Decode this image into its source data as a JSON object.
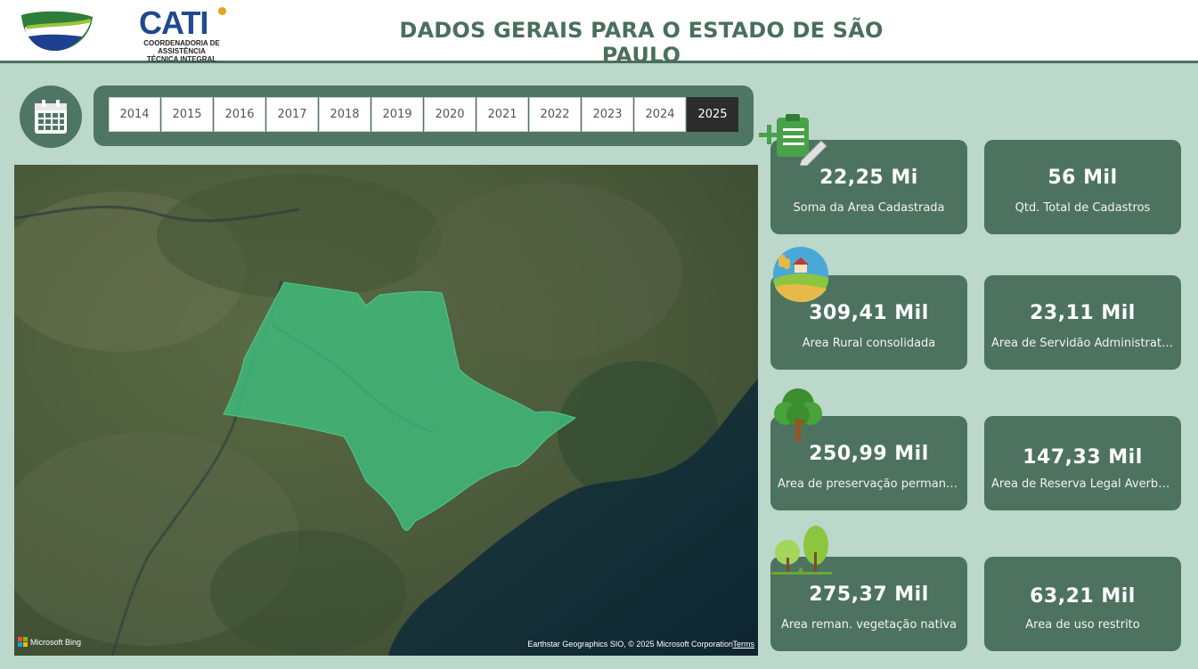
{
  "header": {
    "title": "DADOS GERAIS PARA O ESTADO DE SÃO PAULO",
    "org_logo": {
      "word": "CATI",
      "subtitle_line1": "COORDENADORIA DE ASSISTÊNCIA",
      "subtitle_line2": "TÉCNICA INTEGRAL"
    }
  },
  "year_filter": {
    "icon": "calendar-icon",
    "years": [
      "2014",
      "2015",
      "2016",
      "2017",
      "2018",
      "2019",
      "2020",
      "2021",
      "2022",
      "2023",
      "2024",
      "2025"
    ],
    "selected": "2025"
  },
  "map": {
    "provider_label": "Microsoft Bing",
    "copyright": "Earthstar Geographics SIO, © 2025 Microsoft Corporation",
    "terms_label": "Terms",
    "highlight_color": "#3fb87a"
  },
  "kpis": [
    {
      "value": "22,25 Mi",
      "label": "Soma da Área Cadastrada"
    },
    {
      "value": "56 Mil",
      "label": "Qtd. Total de Cadastros"
    },
    {
      "value": "309,41 Mil",
      "label": "Área Rural consolidada"
    },
    {
      "value": "23,11 Mil",
      "label": "Área de Servidão Administrativa"
    },
    {
      "value": "250,99 Mil",
      "label": "Área de preservação permane..."
    },
    {
      "value": "147,33 Mil",
      "label": "Área de Reserva Legal Averbada"
    },
    {
      "value": "275,37 Mil",
      "label": "Área reman. vegetação nativa"
    },
    {
      "value": "63,21 Mil",
      "label": "Área de uso restrito"
    }
  ],
  "colors": {
    "background": "#bcd8ca",
    "card": "#4d7360",
    "title": "#4a6f5c",
    "selected_year": "#2c2c2c"
  }
}
